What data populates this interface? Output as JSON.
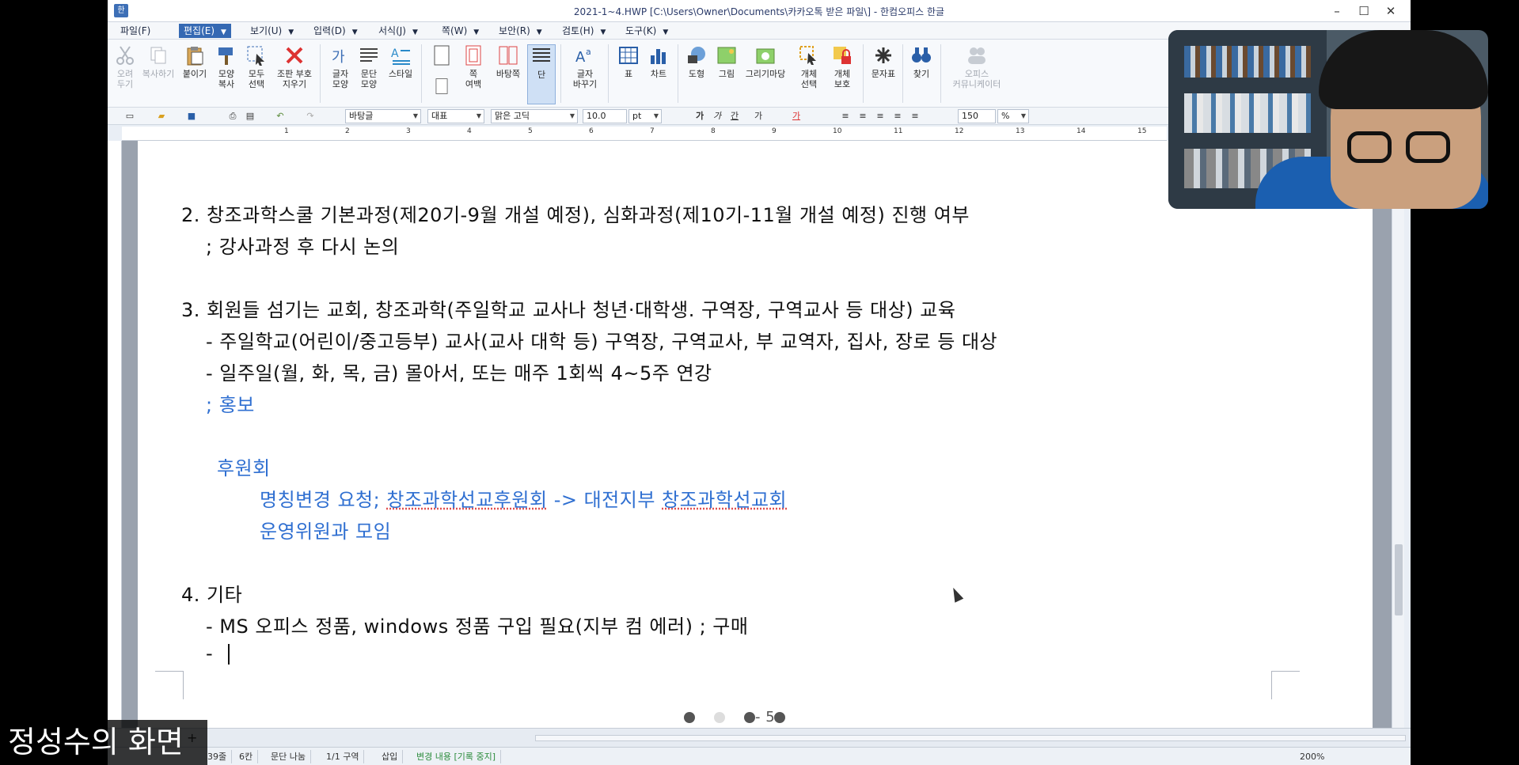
{
  "window": {
    "title": "2021-1~4.HWP [C:\\Users\\Owner\\Documents\\카카오톡 받은 파일\\] - 한컴오피스 한글",
    "icon_label": "한",
    "minimize": "–",
    "maximize": "☐",
    "close": "✕"
  },
  "menu": [
    {
      "label": "파일(F)",
      "active": false
    },
    {
      "label": "편집(E)",
      "active": true
    },
    {
      "label": "보기(U)",
      "active": false
    },
    {
      "label": "입력(D)",
      "active": false
    },
    {
      "label": "서식(J)",
      "active": false
    },
    {
      "label": "쪽(W)",
      "active": false
    },
    {
      "label": "보안(R)",
      "active": false
    },
    {
      "label": "검토(H)",
      "active": false
    },
    {
      "label": "도구(K)",
      "active": false
    }
  ],
  "ribbon": {
    "cut": "오려\n두기",
    "copy": "복사하기",
    "paste": "붙이기",
    "format_copy": "모양\n복사",
    "select_all": "모두\n선택",
    "clear_protect": "조판 부호\n지우기",
    "char_shape": "글자\n모양",
    "para_shape": "문단\n모양",
    "style": "스타일",
    "page_margin": "쪽\n여백",
    "page_bg": "바탕쪽",
    "column": "단",
    "replace": "글자\n바꾸기",
    "table": "표",
    "chart": "차트",
    "shape": "도형",
    "picture": "그림",
    "draw": "그리기마당",
    "obj_select": "개체\n선택",
    "obj_protect": "개체\n보호",
    "symbol": "문자표",
    "find": "찾기",
    "office_comm": "오피스\n커뮤니케이터"
  },
  "format": {
    "style": "바탕글",
    "lang": "대표",
    "font": "맑은 고딕",
    "size": "10.0",
    "unit": "pt",
    "ratio": "150",
    "ratio_unit": "%"
  },
  "ruler_numbers": [
    "1",
    "2",
    "3",
    "4",
    "5",
    "6",
    "7",
    "8",
    "9",
    "10",
    "11",
    "12",
    "13",
    "14",
    "15"
  ],
  "document": {
    "line1": "2. 창조과학스쿨 기본과정(제20기-9월 개설 예정), 심화과정(제10기-11월 개설 예정) 진행 여부",
    "line2": "; 강사과정 후 다시 논의",
    "line3": "3. 회원들 섬기는 교회, 창조과학(주일학교 교사나 청년·대학생. 구역장, 구역교사 등 대상) 교육",
    "line4": "- 주일학교(어린이/중고등부) 교사(교사 대학 등) 구역장, 구역교사, 부 교역자, 집사, 장로 등 대상",
    "line5": "- 일주일(월, 화, 목, 금) 몰아서, 또는 매주 1회씩 4~5주 연강",
    "line6": "; 홍보",
    "line7": "후원회",
    "line8_a": "명칭변경 요청; ",
    "line8_b": "창조과학선교후원회",
    "line8_c": " -> 대전지부 ",
    "line8_d": "창조과학선교회",
    "line9": "운영위원과 모임",
    "line10": "4. 기타",
    "line11": "- MS 오피스 정품, windows 정품 구입 필요(지부 컴 에러)  ; 구매",
    "line12": "- "
  },
  "page_indicator": "- 5 -",
  "status": {
    "line": "39줄",
    "col": "6칸",
    "split": "문단 나눔",
    "section": "1/1 구역",
    "mode": "삽입",
    "track": "변경 내용 [기록 중지]",
    "zoom": "200%"
  },
  "tab_add": "+",
  "caption": "정성수의 화면",
  "colors": {
    "menu_active": "#3569b3",
    "doc_blue": "#2f6fd1",
    "status_green": "#2c8c3c"
  }
}
